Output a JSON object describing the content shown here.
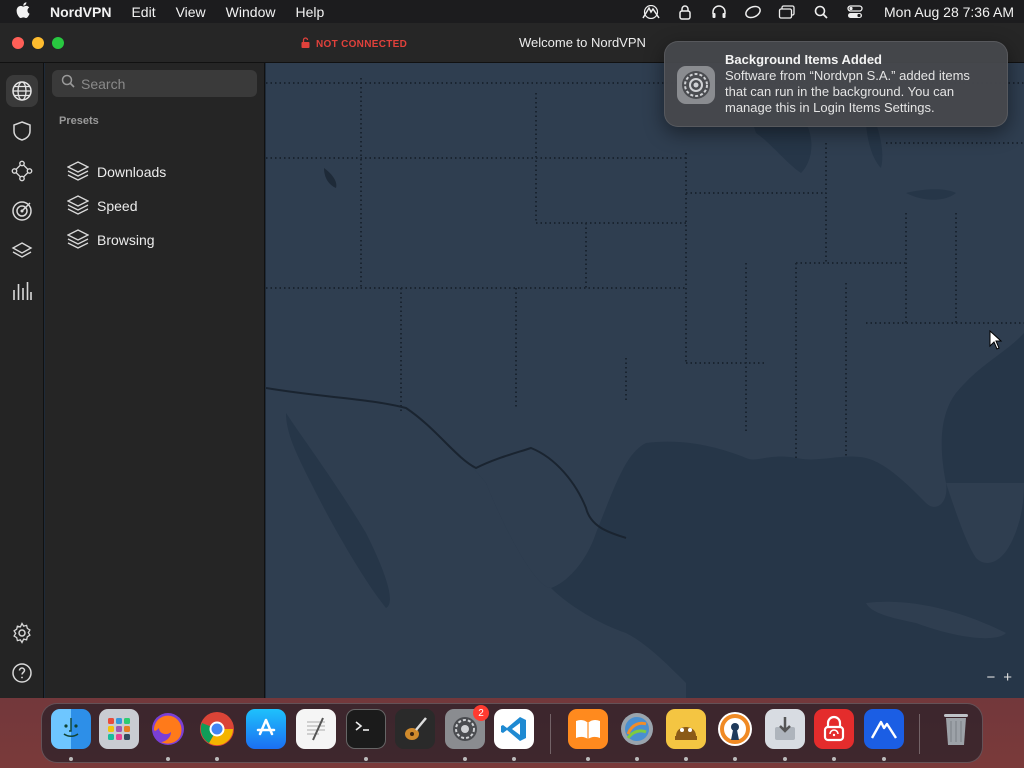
{
  "menubar": {
    "app_name": "NordVPN",
    "menus": [
      "Edit",
      "View",
      "Window",
      "Help"
    ],
    "status_icons": [
      "nordvpn-status-icon",
      "lock-status-icon",
      "headphones-icon",
      "creative-cloud-icon",
      "window-icon",
      "search-icon",
      "control-center-icon"
    ],
    "clock": "Mon Aug 28  7:36 AM"
  },
  "window": {
    "title": "Welcome to NordVPN",
    "connection_status": "NOT CONNECTED"
  },
  "rail": {
    "items": [
      {
        "name": "globe-icon",
        "active": true
      },
      {
        "name": "shield-icon",
        "active": false
      },
      {
        "name": "meshnet-icon",
        "active": false
      },
      {
        "name": "target-icon",
        "active": false
      },
      {
        "name": "layers-icon",
        "active": false
      },
      {
        "name": "stats-icon",
        "active": false
      }
    ],
    "bottom": [
      "settings-icon",
      "help-icon"
    ]
  },
  "sidebar": {
    "search_placeholder": "Search",
    "section_title": "Presets",
    "presets": [
      {
        "label": "Downloads"
      },
      {
        "label": "Speed"
      },
      {
        "label": "Browsing"
      }
    ]
  },
  "map": {
    "zoom_out": "−",
    "zoom_in": "+"
  },
  "notification": {
    "title": "Background Items Added",
    "body": "Software from “Nordvpn S.A.” added items that can run in the background. You can manage this in Login Items Settings."
  },
  "dock": {
    "apps": [
      {
        "name": "finder",
        "running": true
      },
      {
        "name": "launchpad",
        "running": false
      },
      {
        "name": "firefox",
        "running": true
      },
      {
        "name": "chrome",
        "running": true
      },
      {
        "name": "app-store",
        "running": false
      },
      {
        "name": "textedit",
        "running": false
      },
      {
        "name": "terminal",
        "running": true
      },
      {
        "name": "garageband",
        "running": false
      },
      {
        "name": "system-settings",
        "running": true,
        "badge": "2"
      },
      {
        "name": "vscode",
        "running": true
      },
      {
        "name": "books",
        "running": true
      },
      {
        "name": "migration-assistant",
        "running": true
      },
      {
        "name": "cyberduck",
        "running": true
      },
      {
        "name": "openvpn",
        "running": true
      },
      {
        "name": "installer",
        "running": true
      },
      {
        "name": "vpn-lock",
        "running": true
      },
      {
        "name": "nordvpn",
        "running": true
      },
      {
        "name": "trash",
        "running": false
      }
    ]
  },
  "colors": {
    "accent_red": "#e0413b",
    "map_water": "#263648",
    "map_land": "#2f3e50"
  }
}
